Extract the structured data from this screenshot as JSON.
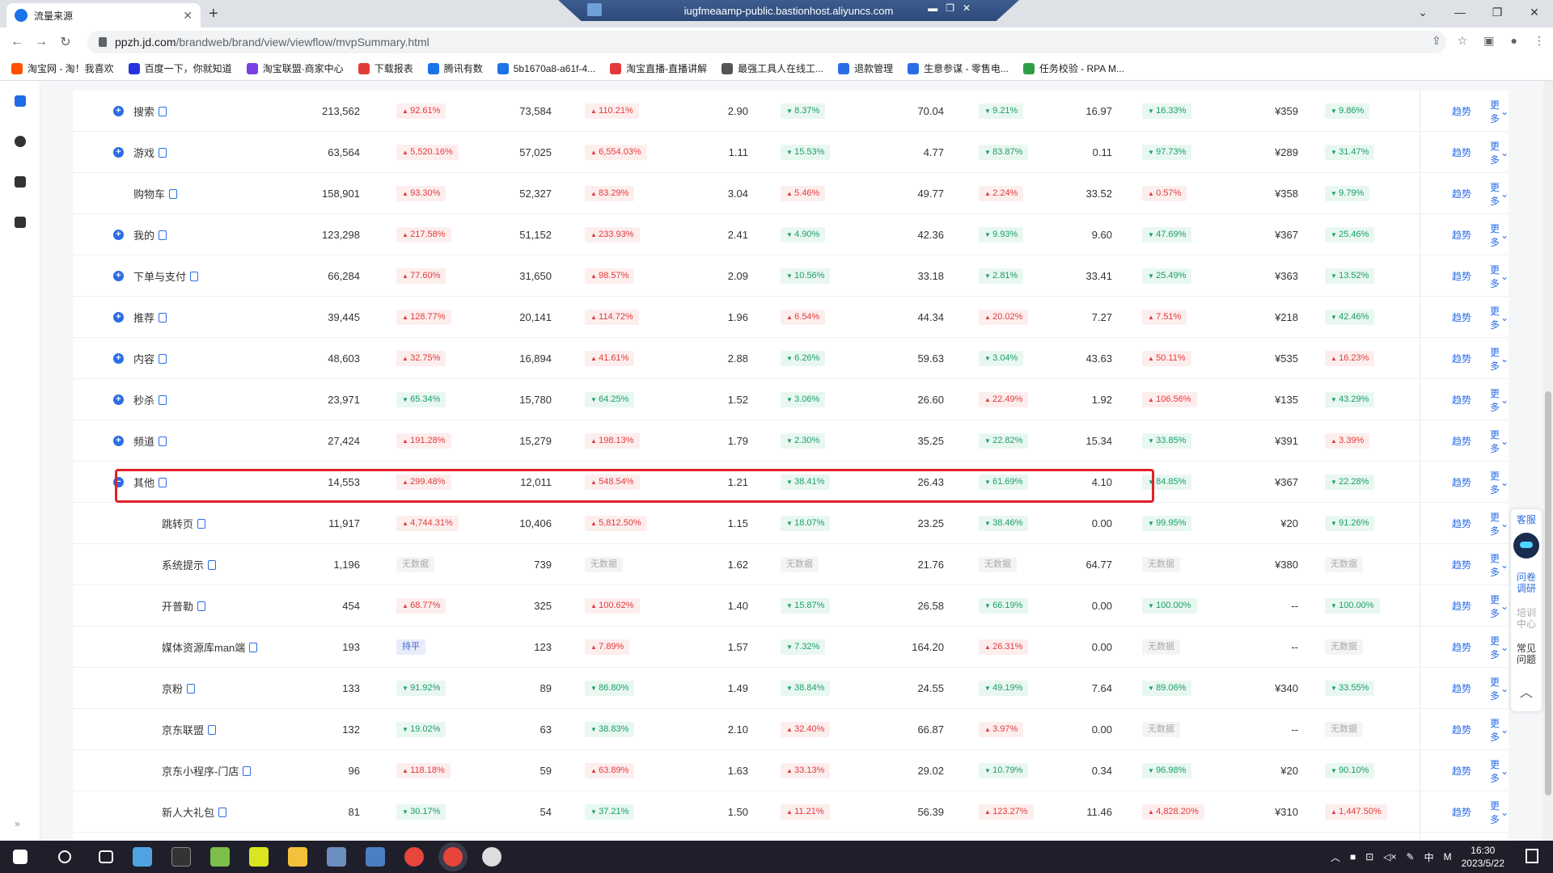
{
  "browser": {
    "tab_title": "流量来源",
    "rdp_title": "iugfmeaamp-public.bastionhost.aliyuncs.com",
    "url_host": "ppzh.jd.com",
    "url_path": "/brandweb/brand/view/viewflow/mvpSummary.html",
    "bookmarks": [
      {
        "label": "淘宝网 - 淘！我喜欢",
        "color": "#ff5000"
      },
      {
        "label": "百度一下，你就知道",
        "color": "#2932e1"
      },
      {
        "label": "淘宝联盟·商家中心",
        "color": "#7b3fe4"
      },
      {
        "label": "下载报表",
        "color": "#e43a3a"
      },
      {
        "label": "腾讯有数",
        "color": "#1a73e8"
      },
      {
        "label": "5b1670a8-a61f-4...",
        "color": "#1a73e8"
      },
      {
        "label": "淘宝直播-直播讲解",
        "color": "#e43a3a"
      },
      {
        "label": "最强工具人在线工...",
        "color": "#555555"
      },
      {
        "label": "退款管理",
        "color": "#2b6de5"
      },
      {
        "label": "生意参谋 - 零售电...",
        "color": "#2b6de5"
      },
      {
        "label": "任务校验 - RPA M...",
        "color": "#2f9e44"
      }
    ]
  },
  "table": {
    "trend_label": "趋势",
    "more_label": "更多",
    "rows": [
      {
        "name": "搜索",
        "level": 0,
        "exp": "+",
        "c1": "213,562",
        "b1": "92.61%",
        "t1": "up",
        "c2": "73,584",
        "b2": "110.21%",
        "t2": "up",
        "c3": "2.90",
        "b3": "8.37%",
        "t3": "down",
        "c4": "70.04",
        "b4": "9.21%",
        "t4": "down",
        "c5": "16.97",
        "b5": "16.33%",
        "t5": "down",
        "c6": "¥359",
        "b6": "9.86%",
        "t6": "down"
      },
      {
        "name": "游戏",
        "level": 0,
        "exp": "+",
        "c1": "63,564",
        "b1": "5,520.16%",
        "t1": "up",
        "c2": "57,025",
        "b2": "6,554.03%",
        "t2": "up",
        "c3": "1.11",
        "b3": "15.53%",
        "t3": "down",
        "c4": "4.77",
        "b4": "83.87%",
        "t4": "down",
        "c5": "0.11",
        "b5": "97.73%",
        "t5": "down",
        "c6": "¥289",
        "b6": "31.47%",
        "t6": "down"
      },
      {
        "name": "购物车",
        "level": 0,
        "exp": "",
        "c1": "158,901",
        "b1": "93.30%",
        "t1": "up",
        "c2": "52,327",
        "b2": "83.29%",
        "t2": "up",
        "c3": "3.04",
        "b3": "5.46%",
        "t3": "up",
        "c4": "49.77",
        "b4": "2.24%",
        "t4": "up",
        "c5": "33.52",
        "b5": "0.57%",
        "t5": "up",
        "c6": "¥358",
        "b6": "9.79%",
        "t6": "down"
      },
      {
        "name": "我的",
        "level": 0,
        "exp": "+",
        "c1": "123,298",
        "b1": "217.58%",
        "t1": "up",
        "c2": "51,152",
        "b2": "233.93%",
        "t2": "up",
        "c3": "2.41",
        "b3": "4.90%",
        "t3": "down",
        "c4": "42.36",
        "b4": "9.93%",
        "t4": "down",
        "c5": "9.60",
        "b5": "47.69%",
        "t5": "down",
        "c6": "¥367",
        "b6": "25.46%",
        "t6": "down"
      },
      {
        "name": "下单与支付",
        "level": 0,
        "exp": "+",
        "c1": "66,284",
        "b1": "77.60%",
        "t1": "up",
        "c2": "31,650",
        "b2": "98.57%",
        "t2": "up",
        "c3": "2.09",
        "b3": "10.56%",
        "t3": "down",
        "c4": "33.18",
        "b4": "2.81%",
        "t4": "down",
        "c5": "33.41",
        "b5": "25.49%",
        "t5": "down",
        "c6": "¥363",
        "b6": "13.52%",
        "t6": "down"
      },
      {
        "name": "推荐",
        "level": 0,
        "exp": "+",
        "c1": "39,445",
        "b1": "128.77%",
        "t1": "up",
        "c2": "20,141",
        "b2": "114.72%",
        "t2": "up",
        "c3": "1.96",
        "b3": "6.54%",
        "t3": "up",
        "c4": "44.34",
        "b4": "20.02%",
        "t4": "up",
        "c5": "7.27",
        "b5": "7.51%",
        "t5": "up",
        "c6": "¥218",
        "b6": "42.46%",
        "t6": "down"
      },
      {
        "name": "内容",
        "level": 0,
        "exp": "+",
        "c1": "48,603",
        "b1": "32.75%",
        "t1": "up",
        "c2": "16,894",
        "b2": "41.61%",
        "t2": "up",
        "c3": "2.88",
        "b3": "6.26%",
        "t3": "down",
        "c4": "59.63",
        "b4": "3.04%",
        "t4": "down",
        "c5": "43.63",
        "b5": "50.11%",
        "t5": "up",
        "c6": "¥535",
        "b6": "16.23%",
        "t6": "up"
      },
      {
        "name": "秒杀",
        "level": 0,
        "exp": "+",
        "c1": "23,971",
        "b1": "65.34%",
        "t1": "down",
        "c2": "15,780",
        "b2": "64.25%",
        "t2": "down",
        "c3": "1.52",
        "b3": "3.06%",
        "t3": "down",
        "c4": "26.60",
        "b4": "22.49%",
        "t4": "up",
        "c5": "1.92",
        "b5": "106.56%",
        "t5": "up",
        "c6": "¥135",
        "b6": "43.29%",
        "t6": "down"
      },
      {
        "name": "频道",
        "level": 0,
        "exp": "+",
        "c1": "27,424",
        "b1": "191.28%",
        "t1": "up",
        "c2": "15,279",
        "b2": "198.13%",
        "t2": "up",
        "c3": "1.79",
        "b3": "2.30%",
        "t3": "down",
        "c4": "35.25",
        "b4": "22.82%",
        "t4": "down",
        "c5": "15.34",
        "b5": "33.85%",
        "t5": "down",
        "c6": "¥391",
        "b6": "3.39%",
        "t6": "up"
      },
      {
        "name": "其他",
        "level": 0,
        "exp": "-",
        "c1": "14,553",
        "b1": "299.48%",
        "t1": "up",
        "c2": "12,011",
        "b2": "548.54%",
        "t2": "up",
        "c3": "1.21",
        "b3": "38.41%",
        "t3": "down",
        "c4": "26.43",
        "b4": "61.69%",
        "t4": "down",
        "c5": "4.10",
        "b5": "84.85%",
        "t5": "down",
        "c6": "¥367",
        "b6": "22.28%",
        "t6": "down"
      },
      {
        "name": "跳转页",
        "level": 1,
        "exp": "",
        "c1": "11,917",
        "b1": "4,744.31%",
        "t1": "up",
        "c2": "10,406",
        "b2": "5,812.50%",
        "t2": "up",
        "c3": "1.15",
        "b3": "18.07%",
        "t3": "down",
        "c4": "23.25",
        "b4": "38.46%",
        "t4": "down",
        "c5": "0.00",
        "b5": "99.95%",
        "t5": "down",
        "c6": "¥20",
        "b6": "91.26%",
        "t6": "down"
      },
      {
        "name": "系统提示",
        "level": 1,
        "exp": "",
        "c1": "1,196",
        "b1": "无数据",
        "t1": "none",
        "c2": "739",
        "b2": "无数据",
        "t2": "none",
        "c3": "1.62",
        "b3": "无数据",
        "t3": "none",
        "c4": "21.76",
        "b4": "无数据",
        "t4": "none",
        "c5": "64.77",
        "b5": "无数据",
        "t5": "none",
        "c6": "¥380",
        "b6": "无数据",
        "t6": "none"
      },
      {
        "name": "开普勒",
        "level": 1,
        "exp": "",
        "c1": "454",
        "b1": "68.77%",
        "t1": "up",
        "c2": "325",
        "b2": "100.62%",
        "t2": "up",
        "c3": "1.40",
        "b3": "15.87%",
        "t3": "down",
        "c4": "26.58",
        "b4": "66.19%",
        "t4": "down",
        "c5": "0.00",
        "b5": "100.00%",
        "t5": "down",
        "c6": "--",
        "b6": "100.00%",
        "t6": "down"
      },
      {
        "name": "媒体资源库man端",
        "level": 1,
        "exp": "",
        "c1": "193",
        "b1": "持平",
        "t1": "flat",
        "c2": "123",
        "b2": "7.89%",
        "t2": "up",
        "c3": "1.57",
        "b3": "7.32%",
        "t3": "down",
        "c4": "164.20",
        "b4": "26.31%",
        "t4": "up",
        "c5": "0.00",
        "b5": "无数据",
        "t5": "none",
        "c6": "--",
        "b6": "无数据",
        "t6": "none"
      },
      {
        "name": "京粉",
        "level": 1,
        "exp": "",
        "c1": "133",
        "b1": "91.92%",
        "t1": "down",
        "c2": "89",
        "b2": "86.80%",
        "t2": "down",
        "c3": "1.49",
        "b3": "38.84%",
        "t3": "down",
        "c4": "24.55",
        "b4": "49.19%",
        "t4": "down",
        "c5": "7.64",
        "b5": "89.06%",
        "t5": "down",
        "c6": "¥340",
        "b6": "33.55%",
        "t6": "down"
      },
      {
        "name": "京东联盟",
        "level": 1,
        "exp": "",
        "c1": "132",
        "b1": "19.02%",
        "t1": "down",
        "c2": "63",
        "b2": "38.83%",
        "t2": "down",
        "c3": "2.10",
        "b3": "32.40%",
        "t3": "up",
        "c4": "66.87",
        "b4": "3.97%",
        "t4": "up",
        "c5": "0.00",
        "b5": "无数据",
        "t5": "none",
        "c6": "--",
        "b6": "无数据",
        "t6": "none"
      },
      {
        "name": "京东小程序-门店",
        "level": 1,
        "exp": "",
        "c1": "96",
        "b1": "118.18%",
        "t1": "up",
        "c2": "59",
        "b2": "63.89%",
        "t2": "up",
        "c3": "1.63",
        "b3": "33.13%",
        "t3": "up",
        "c4": "29.02",
        "b4": "10.79%",
        "t4": "down",
        "c5": "0.34",
        "b5": "96.98%",
        "t5": "down",
        "c6": "¥20",
        "b6": "90.10%",
        "t6": "down"
      },
      {
        "name": "新人大礼包",
        "level": 1,
        "exp": "",
        "c1": "81",
        "b1": "30.17%",
        "t1": "down",
        "c2": "54",
        "b2": "37.21%",
        "t2": "down",
        "c3": "1.50",
        "b3": "11.21%",
        "t3": "up",
        "c4": "56.39",
        "b4": "123.27%",
        "t4": "up",
        "c5": "11.46",
        "b5": "4,828.20%",
        "t5": "up",
        "c6": "¥310",
        "b6": "1,447.50%",
        "t6": "up"
      }
    ]
  },
  "float_panel": {
    "service": "客服",
    "survey": "问卷调研",
    "training": "培训中心",
    "faq": "常见问题"
  },
  "taskbar": {
    "time": "16:30",
    "date": "2023/5/22",
    "ime": "中"
  }
}
